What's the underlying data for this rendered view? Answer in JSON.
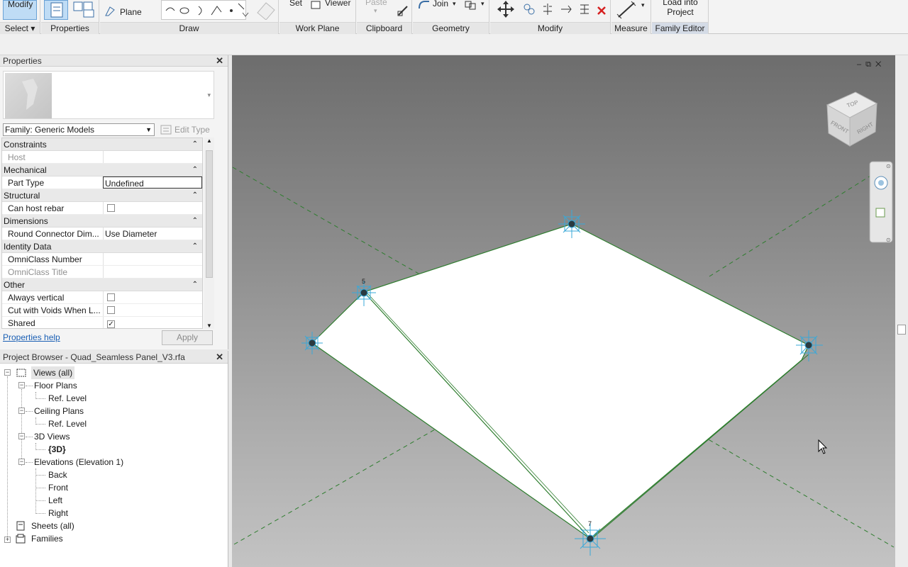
{
  "ribbon": {
    "modify_label": "Modify",
    "select_label": "Select",
    "properties_label": "Properties",
    "plane_label": "Plane",
    "draw_label": "Draw",
    "set_label": "Set",
    "viewer_label": "Viewer",
    "work_plane_label": "Work Plane",
    "paste_label": "Paste",
    "clipboard_label": "Clipboard",
    "join_label": "Join",
    "geometry_label": "Geometry",
    "modify_panel_label": "Modify",
    "measure_label": "Measure",
    "load_into_label_1": "Load into",
    "load_into_label_2": "Project",
    "family_editor_label": "Family Editor"
  },
  "properties": {
    "title": "Properties",
    "family_select": "Family: Generic Models",
    "edit_type_label": "Edit Type",
    "groups": {
      "constraints": "Constraints",
      "mechanical": "Mechanical",
      "structural": "Structural",
      "dimensions": "Dimensions",
      "identity": "Identity Data",
      "other": "Other"
    },
    "rows": {
      "host_key": "Host",
      "host_val": "",
      "part_type_key": "Part Type",
      "part_type_val": "Undefined",
      "can_host_rebar_key": "Can host rebar",
      "round_connector_key": "Round Connector Dim...",
      "round_connector_val": "Use Diameter",
      "omniclass_number_key": "OmniClass Number",
      "omniclass_title_key": "OmniClass Title",
      "always_vertical_key": "Always vertical",
      "cut_with_voids_key": "Cut with Voids When L...",
      "shared_key": "Shared"
    },
    "help_link": "Properties help",
    "apply_label": "Apply"
  },
  "browser": {
    "title": "Project Browser - Quad_Seamless Panel_V3.rfa",
    "views_all": "Views (all)",
    "floor_plans": "Floor Plans",
    "ref_level_1": "Ref. Level",
    "ceiling_plans": "Ceiling Plans",
    "ref_level_2": "Ref. Level",
    "views_3d": "3D Views",
    "view_3d": "{3D}",
    "elevations": "Elevations (Elevation 1)",
    "back": "Back",
    "front": "Front",
    "left": "Left",
    "right": "Right",
    "sheets_all": "Sheets (all)",
    "families": "Families"
  },
  "viewport": {
    "viewcube_top": "TOP",
    "viewcube_front": "FRONT",
    "viewcube_right": "RIGHT",
    "point_label_5": "5",
    "point_label_7": "7"
  },
  "colors": {
    "accent_blue": "#3aa8d8",
    "edge_green": "#2a7a2a",
    "panel_white": "#ffffff"
  }
}
